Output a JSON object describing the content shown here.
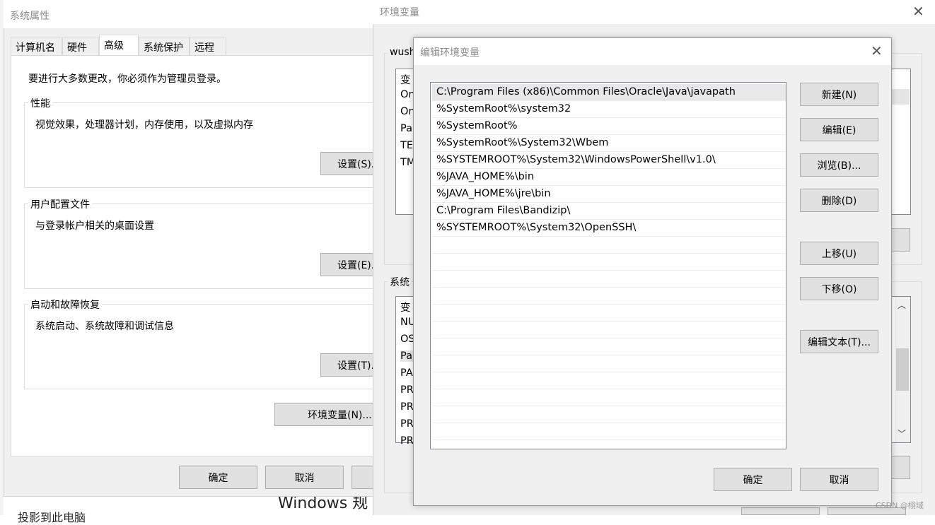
{
  "sysprops": {
    "title": "系统属性",
    "tabs": [
      "计算机名",
      "硬件",
      "高级",
      "系统保护",
      "远程"
    ],
    "admin_note": "要进行大多数更改，你必须作为管理员登录。",
    "perf": {
      "title": "性能",
      "desc": "视觉效果，处理器计划，内存使用，以及虚拟内存",
      "button": "设置(S)..."
    },
    "profile": {
      "title": "用户配置文件",
      "desc": "与登录帐户相关的桌面设置",
      "button": "设置(E)..."
    },
    "startup": {
      "title": "启动和故障恢复",
      "desc": "系统启动、系统故障和调试信息",
      "button": "设置(T)..."
    },
    "env_button": "环境变量(N)...",
    "ok": "确定",
    "cancel": "取消"
  },
  "envvars": {
    "title": "环境变量",
    "user_group_title": "wush",
    "user_rows": [
      "变",
      "On",
      "On",
      "Pa",
      "TE",
      "TM"
    ],
    "sys_group_title": "系统",
    "sys_rows": [
      "变",
      "NU",
      "OS",
      "Pa",
      "PA",
      "PR",
      "PR",
      "PR",
      "PR"
    ]
  },
  "editenv": {
    "title": "编辑环境变量",
    "paths": [
      "C:\\Program Files (x86)\\Common Files\\Oracle\\Java\\javapath",
      "%SystemRoot%\\system32",
      "%SystemRoot%",
      "%SystemRoot%\\System32\\Wbem",
      "%SYSTEMROOT%\\System32\\WindowsPowerShell\\v1.0\\",
      "%JAVA_HOME%\\bin",
      "%JAVA_HOME%\\jre\\bin",
      "C:\\Program Files\\Bandizip\\",
      "%SYSTEMROOT%\\System32\\OpenSSH\\"
    ],
    "buttons": {
      "new": "新建(N)",
      "edit": "编辑(E)",
      "browse": "浏览(B)...",
      "delete": "删除(D)",
      "up": "上移(U)",
      "down": "下移(O)",
      "edit_text": "编辑文本(T)...",
      "ok": "确定",
      "cancel": "取消"
    }
  },
  "background": {
    "windows_text": "Windows 规",
    "bottom_left_text": "投影到此电脑"
  },
  "watermark": "CSDN @栩域"
}
